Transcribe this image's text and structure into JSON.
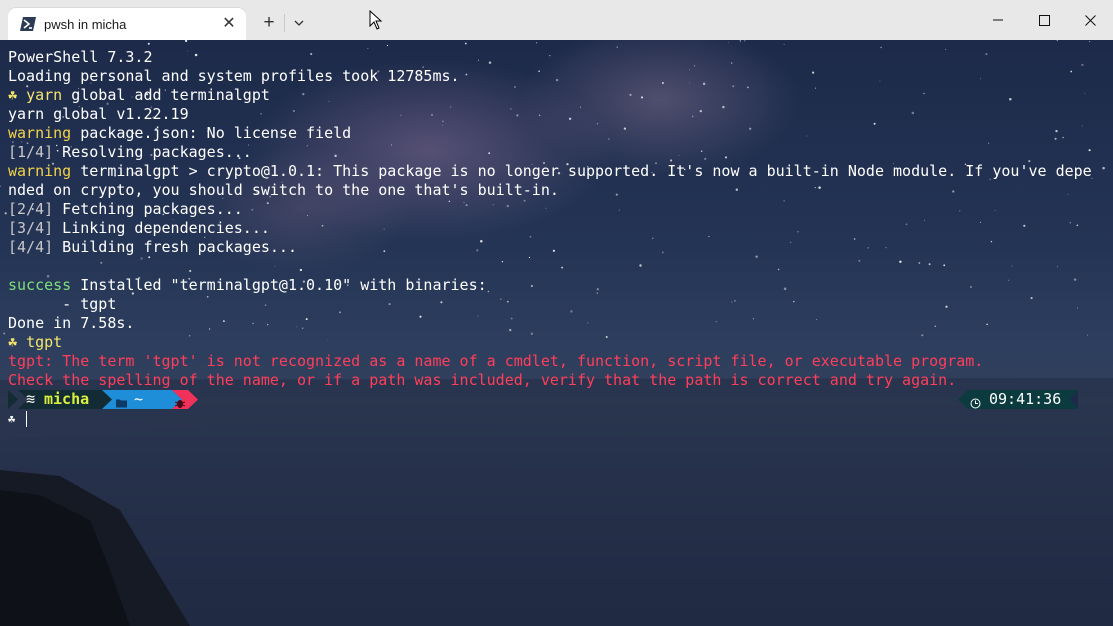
{
  "window": {
    "tab_title": "pwsh in micha",
    "tab_icon": "powershell-icon",
    "new_tab_label": "+",
    "tab_close_label": "✕"
  },
  "terminal": {
    "lines": [
      {
        "segs": [
          {
            "t": "PowerShell 7.3.2",
            "c": "w"
          }
        ]
      },
      {
        "segs": [
          {
            "t": "Loading personal and system profiles took 12785ms.",
            "c": "w"
          }
        ]
      },
      {
        "segs": [
          {
            "t": "☘ ",
            "c": "y"
          },
          {
            "t": "yarn",
            "c": "y"
          },
          {
            "t": " global add terminalgpt",
            "c": "w"
          }
        ]
      },
      {
        "segs": [
          {
            "t": "yarn global v1.22.19",
            "c": "w"
          }
        ]
      },
      {
        "segs": [
          {
            "t": "warning",
            "c": "yel"
          },
          {
            "t": " package.json: No license field",
            "c": "w"
          }
        ]
      },
      {
        "segs": [
          {
            "t": "[1/4]",
            "c": "gray"
          },
          {
            "t": " Resolving packages...",
            "c": "w"
          }
        ]
      },
      {
        "segs": [
          {
            "t": "warning",
            "c": "yel"
          },
          {
            "t": " terminalgpt > crypto@1.0.1: This package is no longer supported. It's now a built-in Node module. If you've depe",
            "c": "w"
          }
        ]
      },
      {
        "segs": [
          {
            "t": "nded on crypto, you should switch to the one that's built-in.",
            "c": "w"
          }
        ]
      },
      {
        "segs": [
          {
            "t": "[2/4]",
            "c": "gray"
          },
          {
            "t": " Fetching packages...",
            "c": "w"
          }
        ]
      },
      {
        "segs": [
          {
            "t": "[3/4]",
            "c": "gray"
          },
          {
            "t": " Linking dependencies...",
            "c": "w"
          }
        ]
      },
      {
        "segs": [
          {
            "t": "[4/4]",
            "c": "gray"
          },
          {
            "t": " Building fresh packages...",
            "c": "w"
          }
        ]
      },
      {
        "segs": [
          {
            "t": "",
            "c": "w"
          }
        ]
      },
      {
        "segs": [
          {
            "t": "success",
            "c": "grn"
          },
          {
            "t": " Installed \"terminalgpt@1.0.10\" with binaries:",
            "c": "w"
          }
        ]
      },
      {
        "segs": [
          {
            "t": "      - tgpt",
            "c": "w"
          }
        ]
      },
      {
        "segs": [
          {
            "t": "Done in 7.58s.",
            "c": "w"
          }
        ]
      },
      {
        "segs": [
          {
            "t": "☘ ",
            "c": "y"
          },
          {
            "t": "tgpt",
            "c": "y"
          }
        ]
      },
      {
        "segs": [
          {
            "t": "tgpt: The term 'tgpt' is not recognized as a name of a cmdlet, function, script file, or executable program.",
            "c": "red"
          }
        ]
      },
      {
        "segs": [
          {
            "t": "Check the spelling of the name, or if a path was included, verify that the path is correct and try again.",
            "c": "red"
          }
        ]
      }
    ],
    "prompt": {
      "user": "micha",
      "dir": "~",
      "user_icon": "arch-icon",
      "dir_icon": "folder-icon",
      "status_icon": "bug-icon",
      "colors": {
        "user_bg": "#122b34",
        "user_fg": "#d9f03f",
        "dir_bg": "#1f8ed8",
        "status_bg": "#f0325a",
        "clock_bg": "#0b3b3f"
      }
    },
    "clock": {
      "icon": "clock-icon",
      "time": "09:41:36"
    },
    "input_glyph": "☘"
  }
}
